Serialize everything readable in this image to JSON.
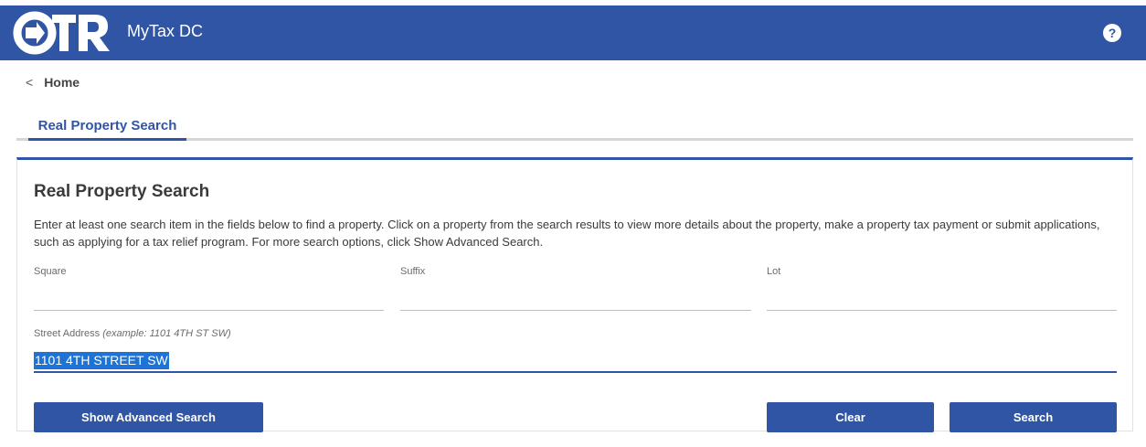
{
  "header": {
    "logo_text": "OTR",
    "app_title": "MyTax DC",
    "help_label": "?"
  },
  "breadcrumb": {
    "label": "Home"
  },
  "tabs": [
    {
      "label": "Real Property Search",
      "active": true
    }
  ],
  "panel": {
    "title": "Real Property Search",
    "description": "Enter at least one search item in the fields below to find a property. Click on a property from the search results to view more details about the property, make a property tax payment or submit applications, such as applying for a tax relief program. For more search options, click Show Advanced Search."
  },
  "fields": {
    "square": {
      "label": "Square",
      "value": ""
    },
    "suffix": {
      "label": "Suffix",
      "value": ""
    },
    "lot": {
      "label": "Lot",
      "value": ""
    },
    "street_address": {
      "label": "Street Address",
      "hint": "(example: 1101 4TH ST SW)",
      "value": "1101 4TH STREET SW"
    }
  },
  "buttons": {
    "advanced": "Show Advanced Search",
    "clear": "Clear",
    "search": "Search"
  },
  "colors": {
    "brand": "#2f55a4",
    "selection": "#1e74d6"
  }
}
